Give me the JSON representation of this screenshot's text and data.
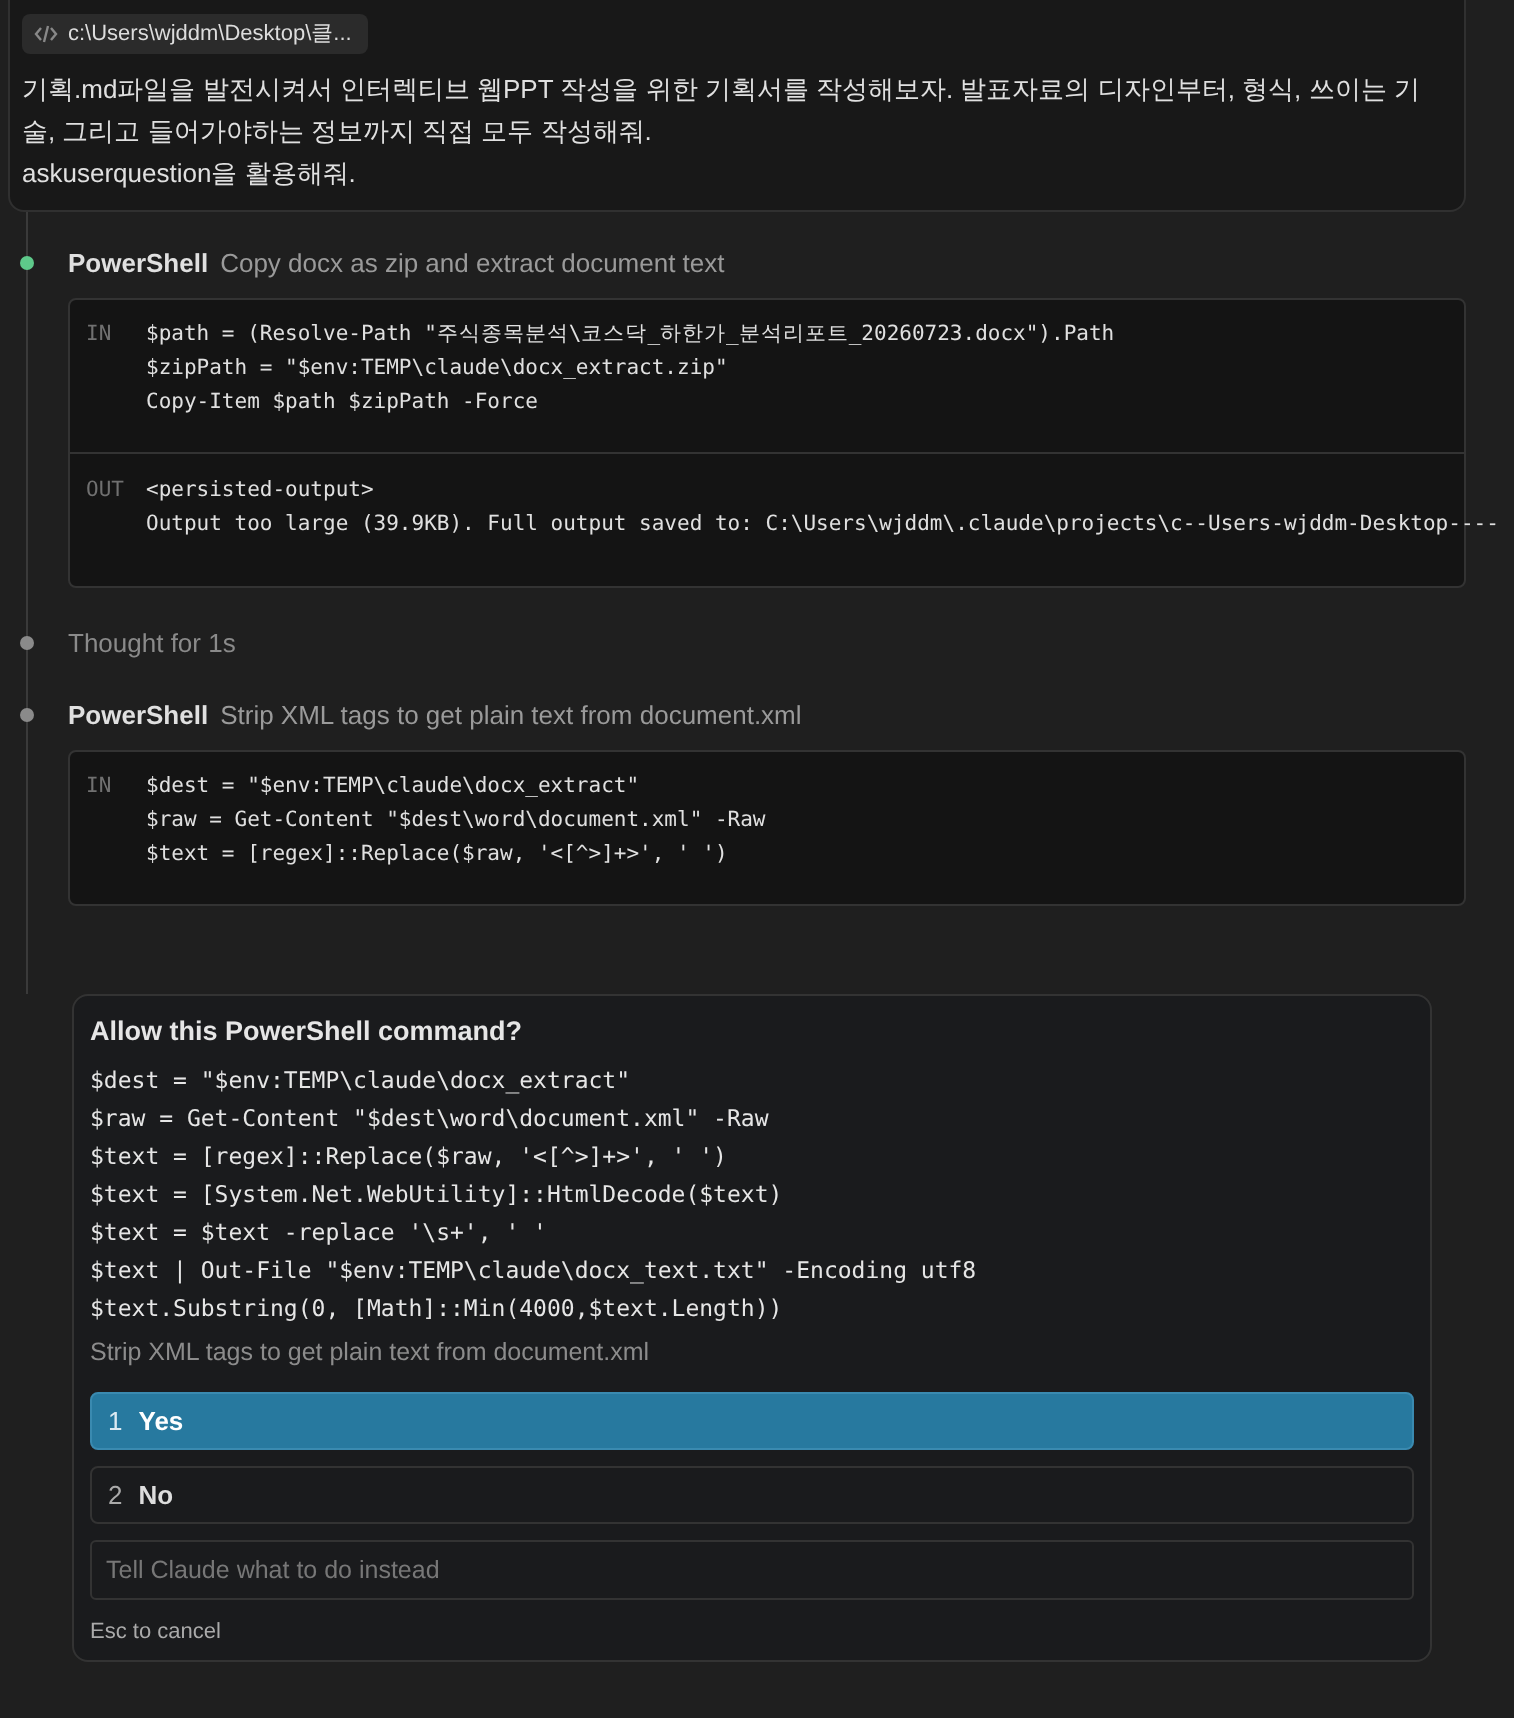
{
  "user_message": {
    "file_chip": "c:\\Users\\wjddm\\Desktop\\클...",
    "lines": [
      "기획.md파일을 발전시켜서 인터렉티브 웹PPT 작성을 위한 기획서를 작성해보자. 발표자료의 디자인부터, 형식, 쓰이는 기술, 그리고 들어가야하는 정보까지 직접 모두 작성해줘.",
      "askuserquestion을 활용해줘."
    ]
  },
  "steps": [
    {
      "kind": "tool",
      "color": "#5ec98a",
      "tool": "PowerShell",
      "description": "Copy docx as zip and extract document text",
      "sections": [
        {
          "label": "IN",
          "lines": [
            "$path = (Resolve-Path \"주식종목분석\\코스닥_하한가_분석리포트_20260723.docx\").Path",
            "$zipPath = \"$env:TEMP\\claude\\docx_extract.zip\"",
            "Copy-Item $path $zipPath -Force"
          ]
        },
        {
          "label": "OUT",
          "lines": [
            "<persisted-output>",
            "Output too large (39.9KB). Full output saved to: C:\\Users\\wjddm\\.claude\\projects\\c--Users-wjddm-Desktop----"
          ]
        }
      ]
    },
    {
      "kind": "thought",
      "color": "#8a8a8a",
      "text": "Thought for 1s"
    },
    {
      "kind": "tool",
      "color": "#8a8a8a",
      "tool": "PowerShell",
      "description": "Strip XML tags to get plain text from document.xml",
      "sections": [
        {
          "label": "IN",
          "lines": [
            "$dest = \"$env:TEMP\\claude\\docx_extract\"",
            "$raw = Get-Content \"$dest\\word\\document.xml\" -Raw",
            "$text = [regex]::Replace($raw, '<[^>]+>', ' ')"
          ]
        }
      ]
    }
  ],
  "permission": {
    "title": "Allow this PowerShell command?",
    "command_lines": [
      "$dest = \"$env:TEMP\\claude\\docx_extract\"",
      "$raw = Get-Content \"$dest\\word\\document.xml\" -Raw",
      "$text = [regex]::Replace($raw, '<[^>]+>', ' ')",
      "$text = [System.Net.WebUtility]::HtmlDecode($text)",
      "$text = $text -replace '\\s+', ' '",
      "$text | Out-File \"$env:TEMP\\claude\\docx_text.txt\" -Encoding utf8",
      "$text.Substring(0, [Math]::Min(4000,$text.Length))"
    ],
    "description": "Strip XML tags to get plain text from document.xml",
    "options": [
      {
        "number": "1",
        "label": "Yes",
        "selected": true
      },
      {
        "number": "2",
        "label": "No",
        "selected": false
      }
    ],
    "input": {
      "placeholder": "Tell Claude what to do instead"
    },
    "hint": "Esc to cancel"
  }
}
